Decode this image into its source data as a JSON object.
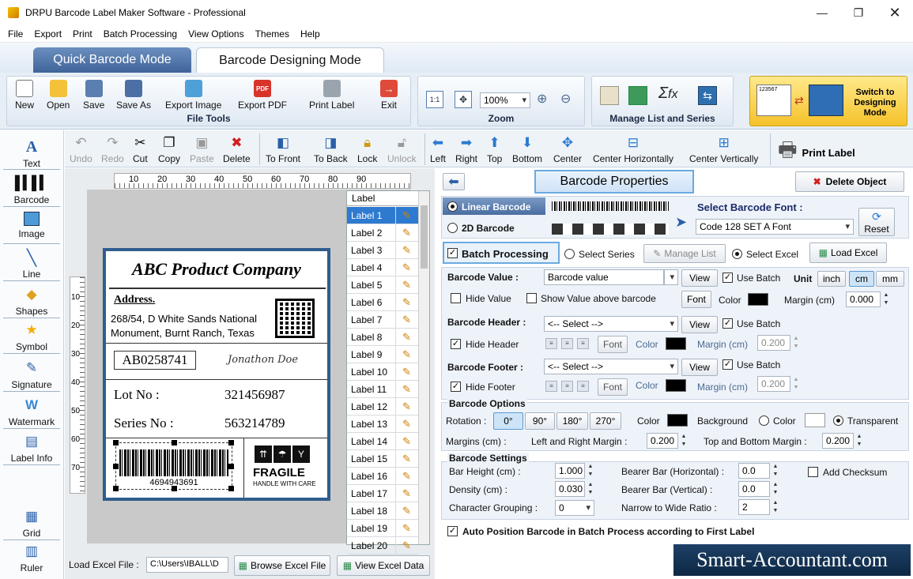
{
  "window": {
    "title": "DRPU Barcode Label Maker Software - Professional"
  },
  "menu": [
    "File",
    "Export",
    "Print",
    "Batch Processing",
    "View Options",
    "Themes",
    "Help"
  ],
  "modes": {
    "quick": "Quick Barcode Mode",
    "designing": "Barcode Designing Mode"
  },
  "file_tools": {
    "label": "File Tools",
    "buttons": [
      "New",
      "Open",
      "Save",
      "Save As",
      "Export Image",
      "Export PDF",
      "Print Label",
      "Exit"
    ]
  },
  "zoom": {
    "label": "Zoom",
    "value": "100%",
    "fit": "1:1"
  },
  "manage": {
    "label": "Manage List and Series"
  },
  "switch_mode": {
    "label": "Switch to Designing Mode",
    "preview_text": "123567"
  },
  "sidebar": [
    "Text",
    "Barcode",
    "Image",
    "Line",
    "Shapes",
    "Symbol",
    "Signature",
    "Watermark",
    "Label Info",
    "Grid",
    "Ruler"
  ],
  "edit_toolbar": {
    "undo": "Undo",
    "redo": "Redo",
    "cut": "Cut",
    "copy": "Copy",
    "paste": "Paste",
    "delete": "Delete",
    "to_front": "To Front",
    "to_back": "To Back",
    "lock": "Lock",
    "unlock": "Unlock",
    "left": "Left",
    "right": "Right",
    "top": "Top",
    "bottom": "Bottom",
    "center": "Center",
    "center_h": "Center Horizontally",
    "center_v": "Center Vertically",
    "print_label": "Print Label"
  },
  "ruler": {
    "h": [
      "10",
      "20",
      "30",
      "40",
      "50",
      "60",
      "70",
      "80",
      "90"
    ],
    "v": [
      "10",
      "20",
      "30",
      "40",
      "50",
      "60",
      "70"
    ]
  },
  "label_card": {
    "company": "ABC Product Company",
    "address_title": "Address.",
    "address_1": "268/54, D White Sands National",
    "address_2": "Monument, Burnt Ranch, Texas",
    "code": "AB0258741",
    "signature": "Jonathon Doe",
    "lot_label": "Lot No :",
    "lot_value": "321456987",
    "series_label": "Series No :",
    "series_value": "563214789",
    "barcode_number": "4694943691",
    "fragile": "FRAGILE",
    "handle": "HANDLE WITH CARE"
  },
  "label_list": {
    "header": "Label",
    "items": [
      "Label 1",
      "Label 2",
      "Label 3",
      "Label 4",
      "Label 5",
      "Label 6",
      "Label 7",
      "Label 8",
      "Label 9",
      "Label 10",
      "Label 11",
      "Label 12",
      "Label 13",
      "Label 14",
      "Label 15",
      "Label 16",
      "Label 17",
      "Label 18",
      "Label 19",
      "Label 20"
    ]
  },
  "load_excel": {
    "label": "Load Excel File :",
    "path": "C:\\Users\\IBALL\\D",
    "browse": "Browse Excel File",
    "view": "View Excel Data"
  },
  "props": {
    "title": "Barcode Properties",
    "delete_object": "Delete Object",
    "linear": "Linear Barcode",
    "twod": "2D Barcode",
    "select_font_label": "Select Barcode Font :",
    "font_value": "Code 128 SET A Font",
    "reset": "Reset",
    "batch_processing": "Batch Processing",
    "select_series": "Select Series",
    "manage_list": "Manage List",
    "select_excel": "Select Excel",
    "load_excel": "Load Excel",
    "barcode_value_label": "Barcode Value :",
    "barcode_value": "Barcode value",
    "view": "View",
    "use_batch": "Use Batch",
    "unit": "Unit",
    "inch": "inch",
    "cm": "cm",
    "mm": "mm",
    "hide_value": "Hide Value",
    "show_above": "Show Value above barcode",
    "font": "Font",
    "color": "Color",
    "margin_cm": "Margin (cm)",
    "margin_value": "0.000",
    "header_label": "Barcode Header :",
    "select_placeholder": "<-- Select -->",
    "hide_header": "Hide Header",
    "header_margin": "0.200",
    "footer_label": "Barcode Footer :",
    "hide_footer": "Hide Footer",
    "footer_margin": "0.200",
    "options_title": "Barcode Options",
    "rotation": "Rotation :",
    "rotations": [
      "0°",
      "90°",
      "180°",
      "270°"
    ],
    "background": "Background",
    "transparent": "Transparent",
    "margins_cm": "Margins (cm) :",
    "lr_margin": "Left and Right Margin :",
    "lr_value": "0.200",
    "tb_margin": "Top and Bottom Margin :",
    "tb_value": "0.200",
    "settings_title": "Barcode Settings",
    "bar_height": "Bar Height (cm) :",
    "bar_height_v": "1.000",
    "density": "Density (cm) :",
    "density_v": "0.030",
    "char_group": "Character Grouping :",
    "char_group_v": "0",
    "bearer_h": "Bearer Bar (Horizontal) :",
    "bearer_h_v": "0.0",
    "bearer_v": "Bearer Bar (Vertical) :",
    "bearer_v_v": "0.0",
    "ratio": "Narrow to Wide Ratio :",
    "ratio_v": "2",
    "checksum": "Add Checksum",
    "auto_position": "Auto Position Barcode in Batch Process according to First Label"
  },
  "watermark": "Smart-Accountant.com"
}
